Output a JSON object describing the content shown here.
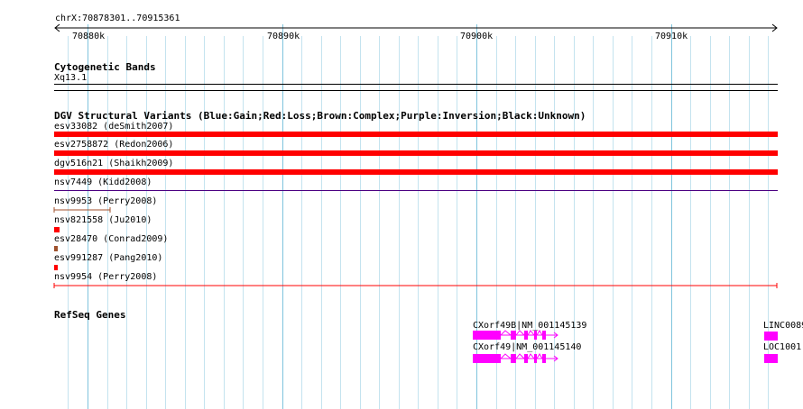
{
  "ruler": {
    "range_label": "chrX:70878301..70915361",
    "ticks": [
      "70880k",
      "70890k",
      "70900k",
      "70910k"
    ]
  },
  "cytoband": {
    "title": "Cytogenetic Bands",
    "band": "Xq13.1"
  },
  "dgv": {
    "title": "DGV Structural Variants (Blue:Gain;Red:Loss;Brown:Complex;Purple:Inversion;Black:Unknown)",
    "variants": [
      {
        "label": "esv33082 (deSmith2007)",
        "type": "Loss",
        "color": "#ff0000"
      },
      {
        "label": "esv2758872 (Redon2006)",
        "type": "Loss",
        "color": "#ff0000"
      },
      {
        "label": "dgv516n21 (Shaikh2009)",
        "type": "Loss",
        "color": "#ff0000"
      },
      {
        "label": "nsv7449 (Kidd2008)",
        "type": "Inversion",
        "color": "#4b0082"
      },
      {
        "label": "nsv9953 (Perry2008)",
        "type": "Complex",
        "color": "#a0522d"
      },
      {
        "label": "nsv821558 (Ju2010)",
        "type": "Loss",
        "color": "#ff0000"
      },
      {
        "label": "esv28470 (Conrad2009)",
        "type": "Complex",
        "color": "#a0522d"
      },
      {
        "label": "esv991287 (Pang2010)",
        "type": "Loss",
        "color": "#ff0000"
      },
      {
        "label": "nsv9954 (Perry2008)",
        "type": "Loss",
        "color": "#ff0000"
      }
    ]
  },
  "refseq": {
    "title": "RefSeq Genes",
    "genes": [
      {
        "label": "CXorf49B|NM_001145139",
        "color": "#ff00ff"
      },
      {
        "label": "CXorf49|NM_001145140",
        "color": "#ff00ff"
      },
      {
        "label": "LINC0089",
        "color": "#ff00ff"
      },
      {
        "label": "LOC1001",
        "color": "#ff00ff"
      }
    ]
  }
}
